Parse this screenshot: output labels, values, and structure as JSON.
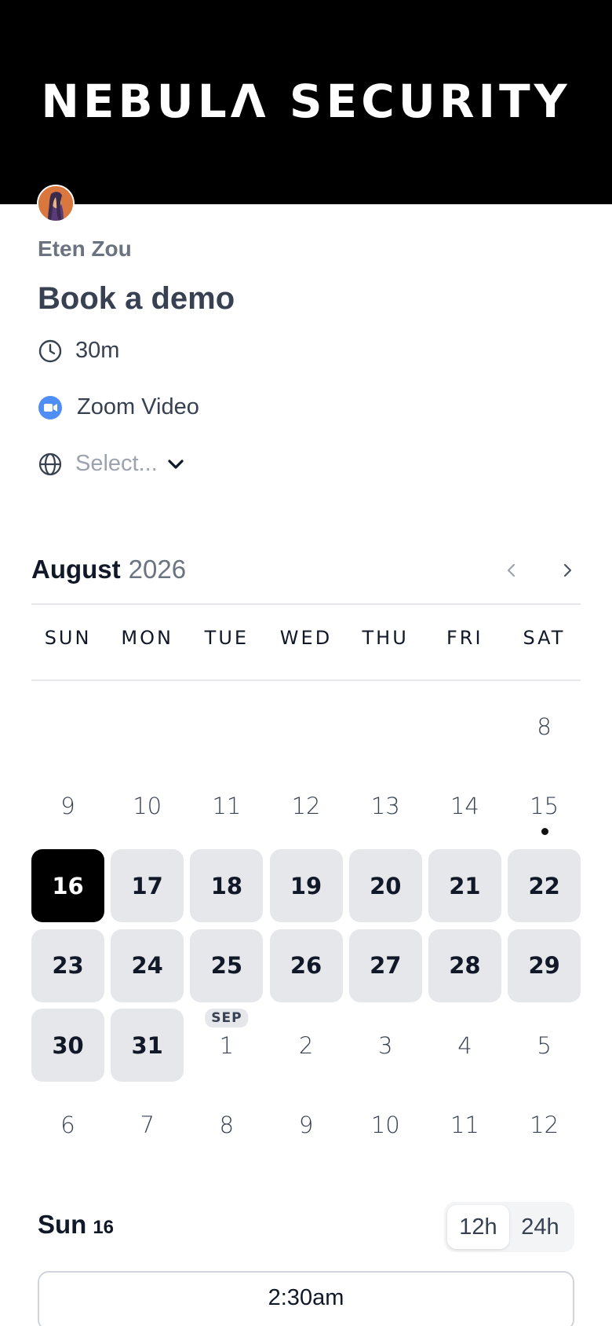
{
  "brand": {
    "name": "NEBULΛ SECURITY"
  },
  "host": {
    "name": "Eten Zou"
  },
  "event": {
    "title": "Book a demo",
    "duration": "30m",
    "location": "Zoom Video",
    "timezone_placeholder": "Select..."
  },
  "icons": {
    "duration": "clock-icon",
    "location": "zoom-video-icon",
    "timezone": "globe-icon",
    "timezone_chevron": "chevron-down-icon",
    "prev": "chevron-left-icon",
    "next": "chevron-right-icon"
  },
  "colors": {
    "selected": "#000000",
    "available": "#e5e7eb",
    "zoom": "#4f8ef7"
  },
  "calendar": {
    "month": "August",
    "year": "2026",
    "weekdays": [
      "SUN",
      "MON",
      "TUE",
      "WED",
      "THU",
      "FRI",
      "SAT"
    ],
    "days": [
      {
        "label": "",
        "state": "empty"
      },
      {
        "label": "",
        "state": "empty"
      },
      {
        "label": "",
        "state": "empty"
      },
      {
        "label": "",
        "state": "empty"
      },
      {
        "label": "",
        "state": "empty"
      },
      {
        "label": "",
        "state": "empty"
      },
      {
        "label": "8",
        "state": "disabled"
      },
      {
        "label": "9",
        "state": "disabled"
      },
      {
        "label": "10",
        "state": "disabled"
      },
      {
        "label": "11",
        "state": "disabled"
      },
      {
        "label": "12",
        "state": "disabled"
      },
      {
        "label": "13",
        "state": "disabled"
      },
      {
        "label": "14",
        "state": "disabled"
      },
      {
        "label": "15",
        "state": "disabled",
        "today": true
      },
      {
        "label": "16",
        "state": "selected"
      },
      {
        "label": "17",
        "state": "available"
      },
      {
        "label": "18",
        "state": "available"
      },
      {
        "label": "19",
        "state": "available"
      },
      {
        "label": "20",
        "state": "available"
      },
      {
        "label": "21",
        "state": "available"
      },
      {
        "label": "22",
        "state": "available"
      },
      {
        "label": "23",
        "state": "available"
      },
      {
        "label": "24",
        "state": "available"
      },
      {
        "label": "25",
        "state": "available"
      },
      {
        "label": "26",
        "state": "available"
      },
      {
        "label": "27",
        "state": "available"
      },
      {
        "label": "28",
        "state": "available"
      },
      {
        "label": "29",
        "state": "available"
      },
      {
        "label": "30",
        "state": "available"
      },
      {
        "label": "31",
        "state": "available"
      },
      {
        "label": "1",
        "state": "disabled",
        "month_tag": "SEP"
      },
      {
        "label": "2",
        "state": "disabled"
      },
      {
        "label": "3",
        "state": "disabled"
      },
      {
        "label": "4",
        "state": "disabled"
      },
      {
        "label": "5",
        "state": "disabled"
      },
      {
        "label": "6",
        "state": "disabled"
      },
      {
        "label": "7",
        "state": "disabled"
      },
      {
        "label": "8",
        "state": "disabled"
      },
      {
        "label": "9",
        "state": "disabled"
      },
      {
        "label": "10",
        "state": "disabled"
      },
      {
        "label": "11",
        "state": "disabled"
      },
      {
        "label": "12",
        "state": "disabled"
      }
    ]
  },
  "slots": {
    "day_name": "Sun",
    "day_number": "16",
    "format_options": [
      "12h",
      "24h"
    ],
    "format_selected": "12h",
    "times": [
      "2:30am"
    ]
  }
}
